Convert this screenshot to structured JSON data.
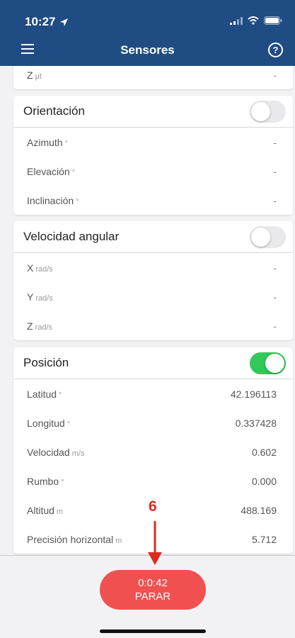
{
  "status": {
    "time": "10:27"
  },
  "nav": {
    "title": "Sensores"
  },
  "partial_card": {
    "rows": [
      {
        "label": "Z",
        "unit": "µt",
        "value": "-"
      }
    ]
  },
  "orientacion": {
    "title": "Orientación",
    "enabled": false,
    "rows": [
      {
        "label": "Azimuth",
        "unit": "°",
        "value": "-"
      },
      {
        "label": "Elevación",
        "unit": "°",
        "value": "-"
      },
      {
        "label": "Inclinación",
        "unit": "°",
        "value": "-"
      }
    ]
  },
  "velocidad_angular": {
    "title": "Velocidad angular",
    "enabled": false,
    "rows": [
      {
        "label": "X",
        "unit": "rad/s",
        "value": "-"
      },
      {
        "label": "Y",
        "unit": "rad/s",
        "value": "-"
      },
      {
        "label": "Z",
        "unit": "rad/s",
        "value": "-"
      }
    ]
  },
  "posicion": {
    "title": "Posición",
    "enabled": true,
    "rows": [
      {
        "label": "Latitud",
        "unit": "°",
        "value": "42.196113"
      },
      {
        "label": "Longitud",
        "unit": "°",
        "value": "0.337428"
      },
      {
        "label": "Velocidad",
        "unit": "m/s",
        "value": "0.602"
      },
      {
        "label": "Rumbo",
        "unit": "°",
        "value": "0.000"
      },
      {
        "label": "Altitud",
        "unit": "m",
        "value": "488.169"
      },
      {
        "label": "Precisión horizontal",
        "unit": "m",
        "value": "5.712"
      }
    ]
  },
  "stop_button": {
    "timer": "0:0:42",
    "label": "PARAR"
  },
  "annotation": {
    "number": "6"
  },
  "colors": {
    "nav_bg": "#1f4c83",
    "toggle_on": "#34c759",
    "stop_button": "#f05050",
    "annotation": "#e02a1a"
  }
}
